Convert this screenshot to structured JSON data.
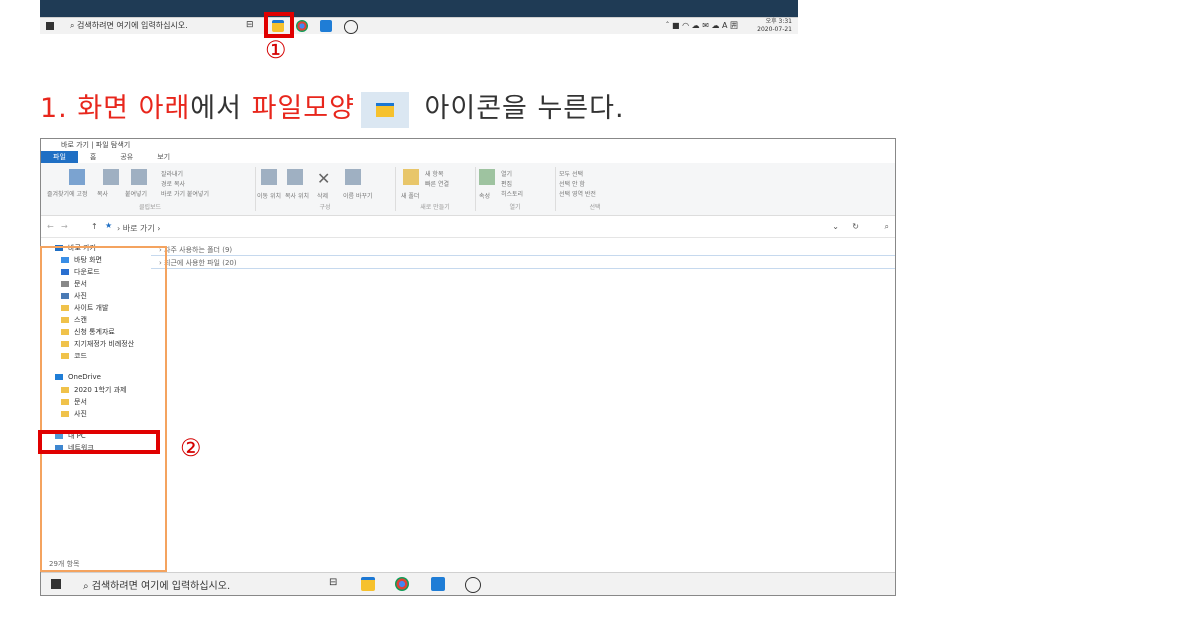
{
  "top_taskbar": {
    "search_placeholder": "검색하려면 여기에 입력하십시오.",
    "task_view": "⊟",
    "tray": "ˆ ■ ◠ ☁ ✉ ☁ A 囲",
    "time": "오후 3:31",
    "date": "2020-07-21"
  },
  "markers": {
    "one": "①",
    "two": "②"
  },
  "instruction": {
    "p1": "1. 화면 아래",
    "p2": "에서 ",
    "p3": "파일모양",
    "p4": " 아이콘을 누른다."
  },
  "explorer": {
    "title": "바로 가기 | 파일 탐색기",
    "tabs": [
      "파일",
      "홈",
      "공유",
      "보기"
    ],
    "ribbon_groups": [
      {
        "label": "클립보드",
        "items": [
          "즐겨찾기에 고정",
          "복사",
          "붙여넣기",
          "잘라내기",
          "경로 복사",
          "바로 가기 붙여넣기"
        ]
      },
      {
        "label": "구성",
        "items": [
          "이동 위치",
          "복사 위치",
          "삭제",
          "이름 바꾸기"
        ]
      },
      {
        "label": "새로 만들기",
        "items": [
          "새 폴더",
          "새 항목",
          "빠른 연결"
        ]
      },
      {
        "label": "열기",
        "items": [
          "속성",
          "열기",
          "편집",
          "히스토리"
        ]
      },
      {
        "label": "선택",
        "items": [
          "모두 선택",
          "선택 안 함",
          "선택 영역 반전"
        ]
      }
    ],
    "address": "› 바로 가기 ›",
    "nav_items": [
      {
        "label": "바로 가기",
        "icon": "star-icon"
      },
      {
        "label": "바탕 화면",
        "icon": "desktop-icon"
      },
      {
        "label": "다운로드",
        "icon": "download-icon"
      },
      {
        "label": "문서",
        "icon": "document-icon"
      },
      {
        "label": "사진",
        "icon": "picture-icon"
      },
      {
        "label": "사이트 개발",
        "icon": "folder-icon"
      },
      {
        "label": "스캔",
        "icon": "folder-icon"
      },
      {
        "label": "신청 통계자료",
        "icon": "folder-icon"
      },
      {
        "label": "지기재정가 비례정산",
        "icon": "folder-icon"
      },
      {
        "label": "코드",
        "icon": "folder-icon"
      },
      {
        "label": "OneDrive",
        "icon": "cloud-icon"
      },
      {
        "label": "2020 1학기 과제",
        "icon": "folder-icon"
      },
      {
        "label": "문서",
        "icon": "folder-icon"
      },
      {
        "label": "사진",
        "icon": "folder-icon"
      },
      {
        "label": "내 PC",
        "icon": "pc-icon"
      },
      {
        "label": "네트워크",
        "icon": "network-icon"
      }
    ],
    "groups": [
      "› 자주 사용하는 폴더 (9)",
      "› 최근에 사용한 파일 (20)"
    ],
    "status": "29개 항목"
  },
  "bottom_taskbar": {
    "search_placeholder": "검색하려면 여기에 입력하십시오.",
    "task_view": "⊟"
  },
  "colors": {
    "marker_red": "#e00000",
    "instruction_red": "#e8261c",
    "nav_highlight": "#f4a35f",
    "file_tab_blue": "#1f6fc4"
  }
}
